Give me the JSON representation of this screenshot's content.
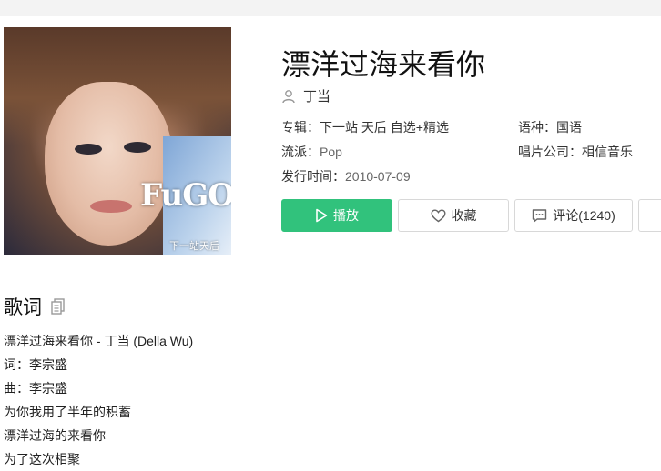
{
  "song": {
    "title": "漂洋过海来看你",
    "artist": "丁当"
  },
  "cover": {
    "logo_text": "FuGOOD",
    "logo_sub": "下一站天后"
  },
  "meta": {
    "album_key": "专辑：",
    "album_value": "下一站 天后 自选+精选",
    "lang_key": "语种：",
    "lang_value": "国语",
    "genre_key": "流派：",
    "genre_value": "Pop",
    "company_key": "唱片公司：",
    "company_value": "相信音乐",
    "release_key": "发行时间：",
    "release_value": "2010-07-09"
  },
  "actions": {
    "play_label": "播放",
    "fav_label": "收藏",
    "comment_label": "评论(1240)"
  },
  "lyrics": {
    "heading": "歌词",
    "lines": [
      "漂洋过海来看你 - 丁当 (Della Wu)",
      "词：李宗盛",
      "曲：李宗盛",
      "为你我用了半年的积蓄",
      "漂洋过海的来看你",
      "为了这次相聚"
    ]
  },
  "colors": {
    "accent": "#31c27c",
    "icon_gray": "#999999"
  },
  "icons": [
    "user-icon",
    "play-icon",
    "heart-icon",
    "comment-icon",
    "copy-icon"
  ]
}
